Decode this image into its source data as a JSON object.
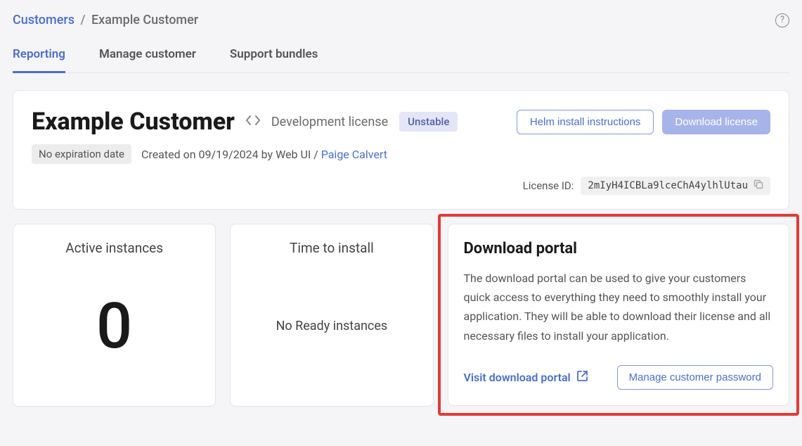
{
  "breadcrumb": {
    "root": "Customers",
    "separator": "/",
    "current": "Example Customer"
  },
  "tabs": {
    "reporting": "Reporting",
    "manage": "Manage customer",
    "support": "Support bundles"
  },
  "header": {
    "name": "Example Customer",
    "license_type": "Development license",
    "channel_badge": "Unstable",
    "helm_button": "Helm install instructions",
    "download_button": "Download license",
    "no_expiration": "No expiration date",
    "created_prefix": "Created on 09/19/2024 by Web UI / ",
    "created_by": "Paige Calvert",
    "license_id_label": "License ID:",
    "license_id": "2mIyH4ICBLa9lceChA4ylhlUtau"
  },
  "cards": {
    "active_instances": {
      "title": "Active instances",
      "value": "0"
    },
    "time_to_install": {
      "title": "Time to install",
      "message": "No Ready instances"
    },
    "download_portal": {
      "title": "Download portal",
      "description": "The download portal can be used to give your customers quick access to everything they need to smoothly install your application. They will be able to download their license and all necessary files to install your application.",
      "visit_link": "Visit download portal",
      "manage_button": "Manage customer password"
    }
  }
}
